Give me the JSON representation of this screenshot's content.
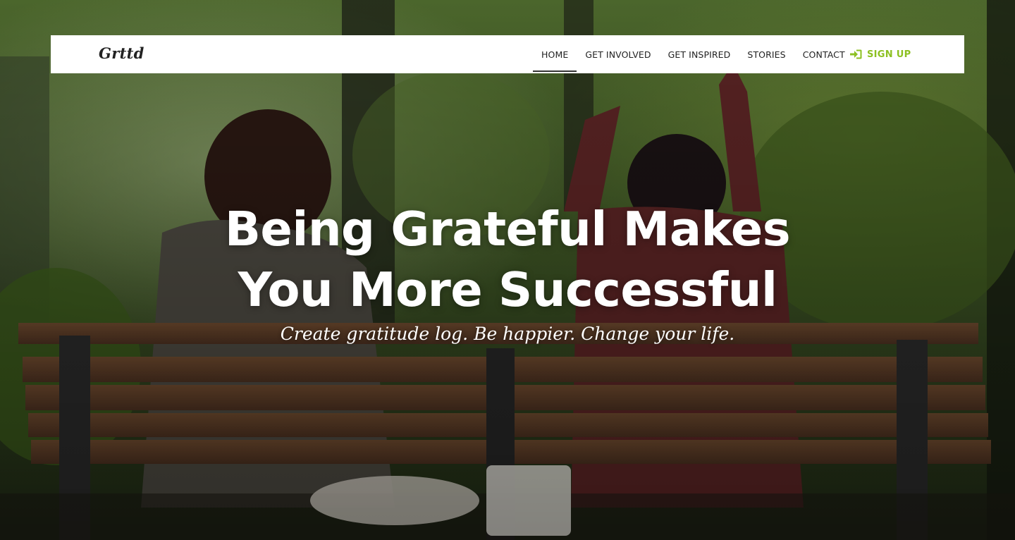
{
  "brand": {
    "name": "Grttd"
  },
  "nav": {
    "items": [
      {
        "label": "HOME",
        "active": true
      },
      {
        "label": "GET INVOLVED",
        "active": false
      },
      {
        "label": "GET INSPIRED",
        "active": false
      },
      {
        "label": "STORIES",
        "active": false
      },
      {
        "label": "CONTACT",
        "active": false
      }
    ],
    "signup": {
      "label": "SIGN UP",
      "icon": "sign-in-icon"
    }
  },
  "hero": {
    "headline_line1": "Being Grateful Makes",
    "headline_line2": "You More Successful",
    "tagline": "Create gratitude log. Be happier. Change your life."
  },
  "colors": {
    "accent": "#8cc021",
    "navbar_bg": "#ffffff",
    "nav_text": "#222222",
    "hero_text": "#ffffff"
  }
}
